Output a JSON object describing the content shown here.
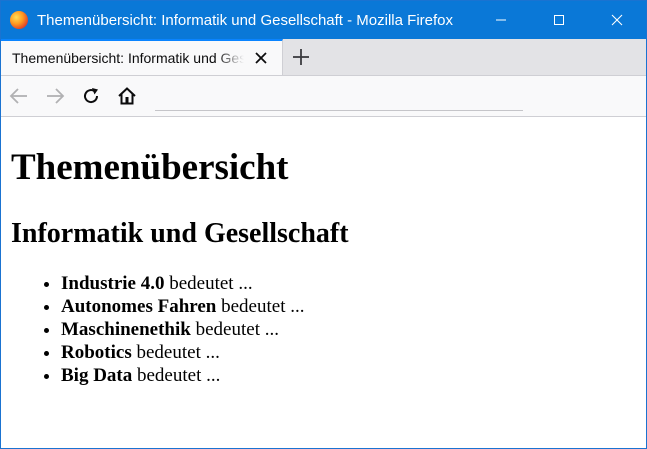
{
  "window": {
    "title": "Themenübersicht: Informatik und Gesellschaft - Mozilla Firefox"
  },
  "tab": {
    "label": "Themenübersicht: Informatik und Gesellschaft"
  },
  "icons": {
    "app": "firefox-icon",
    "minimize": "minimize-icon",
    "maximize": "maximize-icon",
    "close": "close-icon",
    "tab_close": "close-icon",
    "new_tab": "plus-icon",
    "back": "back-arrow-icon",
    "forward": "forward-arrow-icon",
    "reload": "reload-icon",
    "home": "home-icon"
  },
  "colors": {
    "titlebar": "#0a78d7",
    "tab_accent": "#0a84ff"
  },
  "page": {
    "heading": "Themenübersicht",
    "subheading": "Informatik und Gesellschaft",
    "items": [
      {
        "term": "Industrie 4.0",
        "suffix": " bedeutet ..."
      },
      {
        "term": "Autonomes Fahren",
        "suffix": " bedeutet ..."
      },
      {
        "term": "Maschinenethik",
        "suffix": " bedeutet ..."
      },
      {
        "term": "Robotics",
        "suffix": " bedeutet ..."
      },
      {
        "term": "Big Data",
        "suffix": " bedeutet ..."
      }
    ]
  }
}
